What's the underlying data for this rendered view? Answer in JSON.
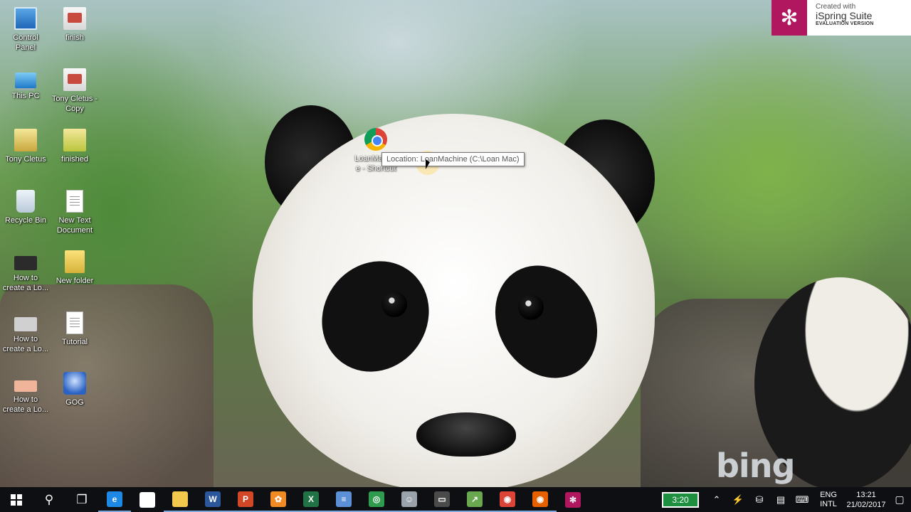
{
  "desktop": {
    "icons": [
      {
        "label": "Control\nPanel",
        "icon": "control-panel-icon"
      },
      {
        "label": "finish",
        "icon": "image-file-icon"
      },
      {
        "label": "This PC",
        "icon": "this-pc-icon"
      },
      {
        "label": "Tony Cletus -\nCopy",
        "icon": "image-file-icon"
      },
      {
        "label": "Tony Cletus",
        "icon": "archive-icon"
      },
      {
        "label": "finished",
        "icon": "archive-icon"
      },
      {
        "label": "Recycle Bin",
        "icon": "recycle-bin-icon"
      },
      {
        "label": "New Text\nDocument",
        "icon": "text-document-icon"
      },
      {
        "label": "How to\ncreate a Lo...",
        "icon": "video-file-icon"
      },
      {
        "label": "New folder",
        "icon": "folder-icon"
      },
      {
        "label": "How to\ncreate a Lo...",
        "icon": "video-file-icon"
      },
      {
        "label": "Tutorial",
        "icon": "text-document-icon"
      },
      {
        "label": "How to\ncreate a Lo...",
        "icon": "video-file-icon"
      },
      {
        "label": "GOG",
        "icon": "gog-icon"
      }
    ],
    "dragged_shortcut": {
      "label": "LoanMachin\ne - Shortcut",
      "icon": "chrome-icon"
    },
    "tooltip": "Location: LoanMachine (C:\\Loan Mac)"
  },
  "watermark": {
    "line1": "Created with",
    "line2": "iSpring Suite",
    "line3": "EVALUATION VERSION",
    "accent": "#b0175f"
  },
  "wallpaper_brand": "bing",
  "taskbar": {
    "apps": [
      {
        "name": "start",
        "icon": "windows-logo-icon"
      },
      {
        "name": "search",
        "icon": "search-icon",
        "glyph": "⚲"
      },
      {
        "name": "task-view",
        "icon": "task-view-icon",
        "glyph": "❐"
      },
      {
        "name": "edge",
        "icon": "edge-icon",
        "glyph": "e",
        "color": "#1e88e5"
      },
      {
        "name": "store",
        "icon": "store-icon",
        "glyph": "🛍",
        "color": "#ffffff"
      },
      {
        "name": "file-explorer",
        "icon": "folder-icon",
        "glyph": "",
        "color": "#f2c94c"
      },
      {
        "name": "word",
        "icon": "word-icon",
        "glyph": "W",
        "color": "#2b579a"
      },
      {
        "name": "powerpoint",
        "icon": "powerpoint-icon",
        "glyph": "P",
        "color": "#d24726"
      },
      {
        "name": "app-orange",
        "icon": "orange-app-icon",
        "glyph": "✿",
        "color": "#f08a24"
      },
      {
        "name": "excel",
        "icon": "excel-icon",
        "glyph": "X",
        "color": "#217346"
      },
      {
        "name": "app-doc",
        "icon": "document-app-icon",
        "glyph": "≡",
        "color": "#5b8fd6"
      },
      {
        "name": "app-green-circle",
        "icon": "green-circle-icon",
        "glyph": "◎",
        "color": "#2e9b4e"
      },
      {
        "name": "app-robot",
        "icon": "robot-icon",
        "glyph": "☺",
        "color": "#9aa3ab"
      },
      {
        "name": "app-window",
        "icon": "window-app-icon",
        "glyph": "▭",
        "color": "#4a4a4a"
      },
      {
        "name": "app-chart",
        "icon": "chart-app-icon",
        "glyph": "↗",
        "color": "#6aa84f"
      },
      {
        "name": "chrome",
        "icon": "chrome-icon",
        "glyph": "◉",
        "color": "#db4437"
      },
      {
        "name": "firefox",
        "icon": "firefox-icon",
        "glyph": "◉",
        "color": "#e66000"
      },
      {
        "name": "ispring",
        "icon": "ispring-icon",
        "glyph": "✻",
        "color": "#b0175f"
      }
    ],
    "battery_time": "3:20",
    "language": {
      "line1": "ENG",
      "line2": "INTL"
    },
    "time": "13:21",
    "date": "21/02/2017"
  }
}
